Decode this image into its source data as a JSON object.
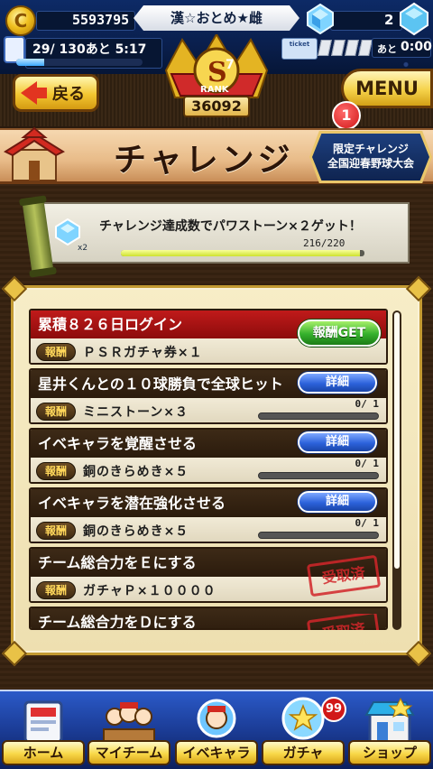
{
  "status": {
    "money": "5593795",
    "player_name": "漢☆おとめ★雌",
    "gems": "2",
    "stamina_text": "29/ 130あと  5:17",
    "stamina_fraction": 0.223,
    "ticket_label": "ticket",
    "ticket_ato": "あと",
    "ticket_time": "0:00",
    "coin_glyph": "C"
  },
  "header": {
    "back_label": "戻る",
    "menu_label": "MENU",
    "rank_label": "RANK",
    "rank_grade": "S",
    "rank_sub": "7",
    "rank_score": "36092",
    "notification_count": "1"
  },
  "title": {
    "text": "チャレンジ",
    "event_button_line1": "限定チャレンジ",
    "event_button_line2": "全国迎春野球大会"
  },
  "banner": {
    "text": "チャレンジ達成数でパワストーン×２ゲット！",
    "gem_multiplier": "x2",
    "progress_text": "216/220",
    "progress_fraction": 0.982
  },
  "reward_tag": "報酬",
  "items": [
    {
      "title": "累積８２６日ログイン",
      "reward": "ＰＳＲガチャ券×１",
      "action": "報酬GET",
      "state": "claimable"
    },
    {
      "title": "星井くんとの１０球勝負で全球ヒット",
      "reward": "ミニストーン×３",
      "action": "詳細",
      "progress_text": "0/     1",
      "fraction": 0
    },
    {
      "title": "イベキャラを覚醒させる",
      "reward": "銅のきらめき×５",
      "action": "詳細",
      "progress_text": "0/     1",
      "fraction": 0
    },
    {
      "title": "イベキャラを潜在強化させる",
      "reward": "銅のきらめき×５",
      "action": "詳細",
      "progress_text": "0/     1",
      "fraction": 0
    },
    {
      "title": "チーム総合力をＥにする",
      "reward": "ガチャＰ×１００００",
      "stamp": "受取済"
    },
    {
      "title": "チーム総合力をＤにする",
      "stamp": "受取済"
    }
  ],
  "nav": {
    "home": "ホーム",
    "my_team": "マイチーム",
    "event_chara": "イベキャラ",
    "gacha": "ガチャ",
    "shop": "ショップ",
    "gacha_badge": "99"
  }
}
